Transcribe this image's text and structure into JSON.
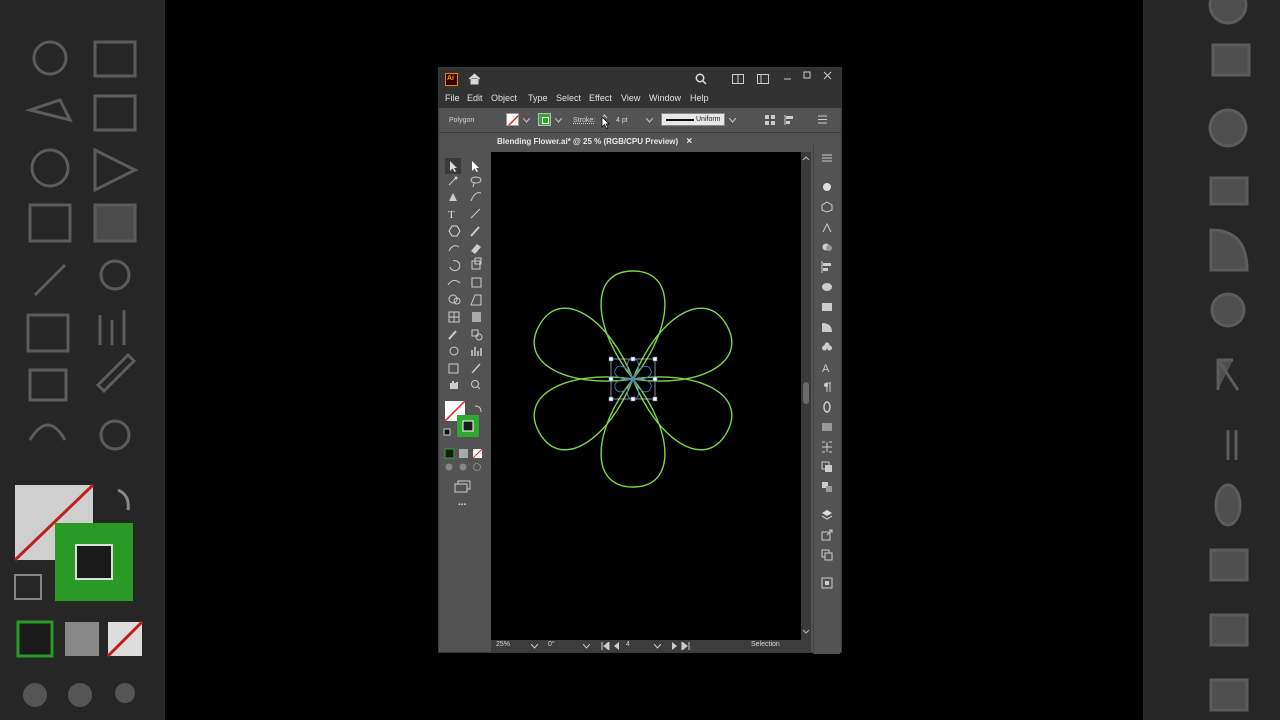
{
  "app": {
    "logo_text": "Ai"
  },
  "menu": [
    "File",
    "Edit",
    "Object",
    "Type",
    "Select",
    "Effect",
    "View",
    "Window",
    "Help"
  ],
  "control_bar": {
    "selection_type": "Polygon",
    "stroke_label": "Stroke:",
    "stroke_weight": "4 pt",
    "profile": "Uniform"
  },
  "document_tab": {
    "title": "Blending Flower.ai* @ 25 % (RGB/CPU Preview)",
    "close": "×"
  },
  "status_bar": {
    "zoom": "25%",
    "rotation": "0°",
    "artboard": "4",
    "tool": "Selection"
  },
  "colors": {
    "stroke": "#2ea82e",
    "fill": "none",
    "flower_stroke": "#7fd44a",
    "panel": "#535353"
  },
  "toolbox": {
    "more": "..."
  }
}
